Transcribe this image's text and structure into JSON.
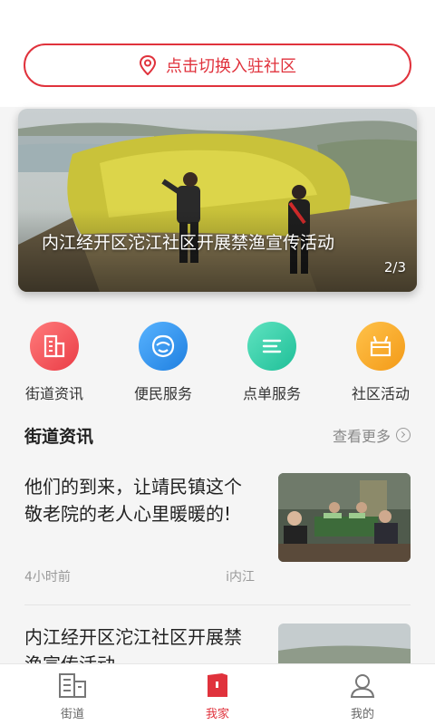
{
  "header": {
    "switch_label": "点击切换入驻社区"
  },
  "banner": {
    "title": "内江经开区沱江社区开展禁渔宣传活动",
    "counter": "2/3"
  },
  "categories": [
    {
      "label": "街道资讯",
      "icon": "building-icon",
      "color": "#f0515a"
    },
    {
      "label": "便民服务",
      "icon": "smile-icon",
      "color": "#2f8fe6"
    },
    {
      "label": "点单服务",
      "icon": "list-icon",
      "color": "#2fcfa8"
    },
    {
      "label": "社区活动",
      "icon": "gift-icon",
      "color": "#f7a325"
    }
  ],
  "section": {
    "title": "街道资讯",
    "more": "查看更多"
  },
  "news": [
    {
      "title": "他们的到来，让靖民镇这个敬老院的老人心里暖暖的!",
      "time": "4小时前",
      "source": "i内江"
    },
    {
      "title": "内江经开区沱江社区开展禁渔宣传活动",
      "time": "",
      "source": ""
    }
  ],
  "tabbar": {
    "items": [
      {
        "label": "街道",
        "icon": "street-icon"
      },
      {
        "label": "我家",
        "icon": "home-icon"
      },
      {
        "label": "我的",
        "icon": "profile-icon"
      }
    ],
    "active_color": "#e0323c"
  }
}
